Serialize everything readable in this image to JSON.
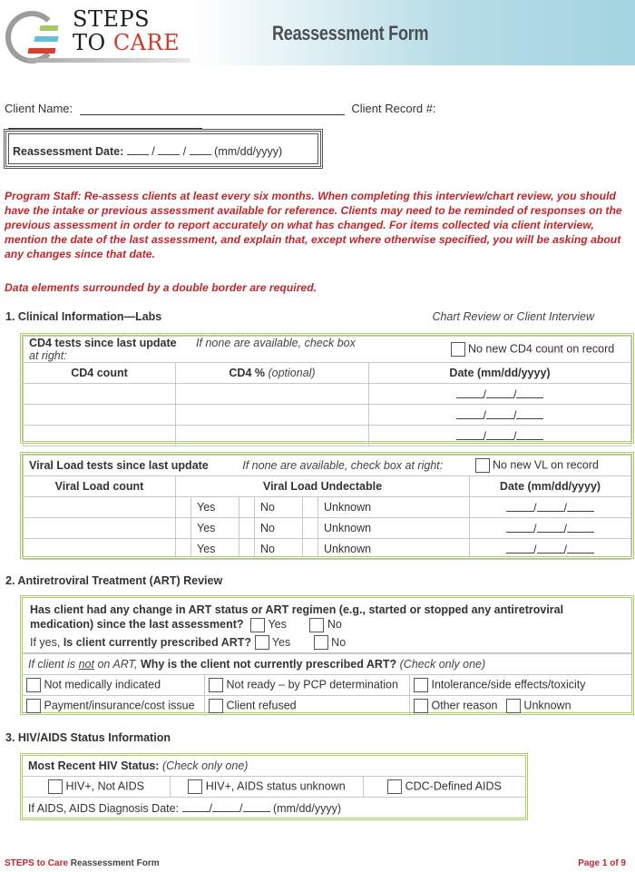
{
  "header": {
    "logo": {
      "line1": "STEPS",
      "line2_a": "TO ",
      "line2_b": "CARE"
    },
    "title": "Reassessment Form"
  },
  "client": {
    "name_label": "Client Name:",
    "name_value": "",
    "record_label": "Client Record #:",
    "record_value": ""
  },
  "reassessment_date": {
    "label": "Reassessment Date:",
    "separator": "/",
    "format": "(mm/dd/yyyy)"
  },
  "instructions": "Program Staff: Re-assess clients at least every six months. When completing this interview/chart review, you should have the intake or previous assessment available for reference. Clients may need to be reminded of responses on the previous assessment in order to report accurately on what has changed. For items collected via client interview, mention the date of the last assessment, and explain that, except where otherwise specified, you will be asking about any changes since that date.",
  "required_note": "Data elements surrounded by a double border are required.",
  "section1": {
    "title": "1. Clinical Information—Labs",
    "note": "Chart Review or Client Interview",
    "cd4": {
      "heading": "CD4 tests since last update",
      "hint": "If none are available, check box at right:",
      "none_label": "No new CD4 count on record",
      "columns": [
        "CD4 count",
        "CD4 %",
        "(optional)",
        "Date (mm/dd/yyyy)"
      ],
      "rows": 3
    },
    "vl": {
      "heading": "Viral Load tests since last update",
      "hint": "If none are available, check box at right:",
      "none_label": "No new VL on record",
      "columns": [
        "Viral Load count",
        "Viral Load Undectable",
        "Date (mm/dd/yyyy)"
      ],
      "options": [
        "Yes",
        "No",
        "Unknown"
      ],
      "rows": 3
    }
  },
  "section2": {
    "title": "2. Antiretroviral Treatment (ART) Review",
    "q1": "Has client had any change in ART status or ART regimen (e.g., started or stopped any antiretroviral medication) since the last assessment?",
    "q2_prefix": "If yes,",
    "q2": "Is client currently prescribed ART?",
    "yes": "Yes",
    "no": "No",
    "q3_prefix_a": "If client is ",
    "q3_not": "not",
    "q3_prefix_b": " on ART,",
    "q3": " Why is the client not currently prescribed ART?",
    "q3_hint": " (Check only one)",
    "reasons": [
      "Not medically indicated",
      "Not ready – by PCP determination",
      "Intolerance/side effects/toxicity",
      "Payment/insurance/cost issue",
      "Client refused",
      "Other reason",
      "Unknown"
    ]
  },
  "section3": {
    "title": "3. HIV/AIDS Status Information",
    "status_label": "Most Recent HIV Status:",
    "status_hint": " (Check only one)",
    "options": [
      "HIV+, Not AIDS",
      "HIV+, AIDS status unknown",
      "CDC-Defined AIDS"
    ],
    "diag_label": "If AIDS, AIDS Diagnosis Date:",
    "diag_format": "(mm/dd/yyyy)"
  },
  "footer": {
    "brand": "STEPS to Care",
    "doc": " Reassessment Form",
    "page": "Page 1 of 9"
  }
}
